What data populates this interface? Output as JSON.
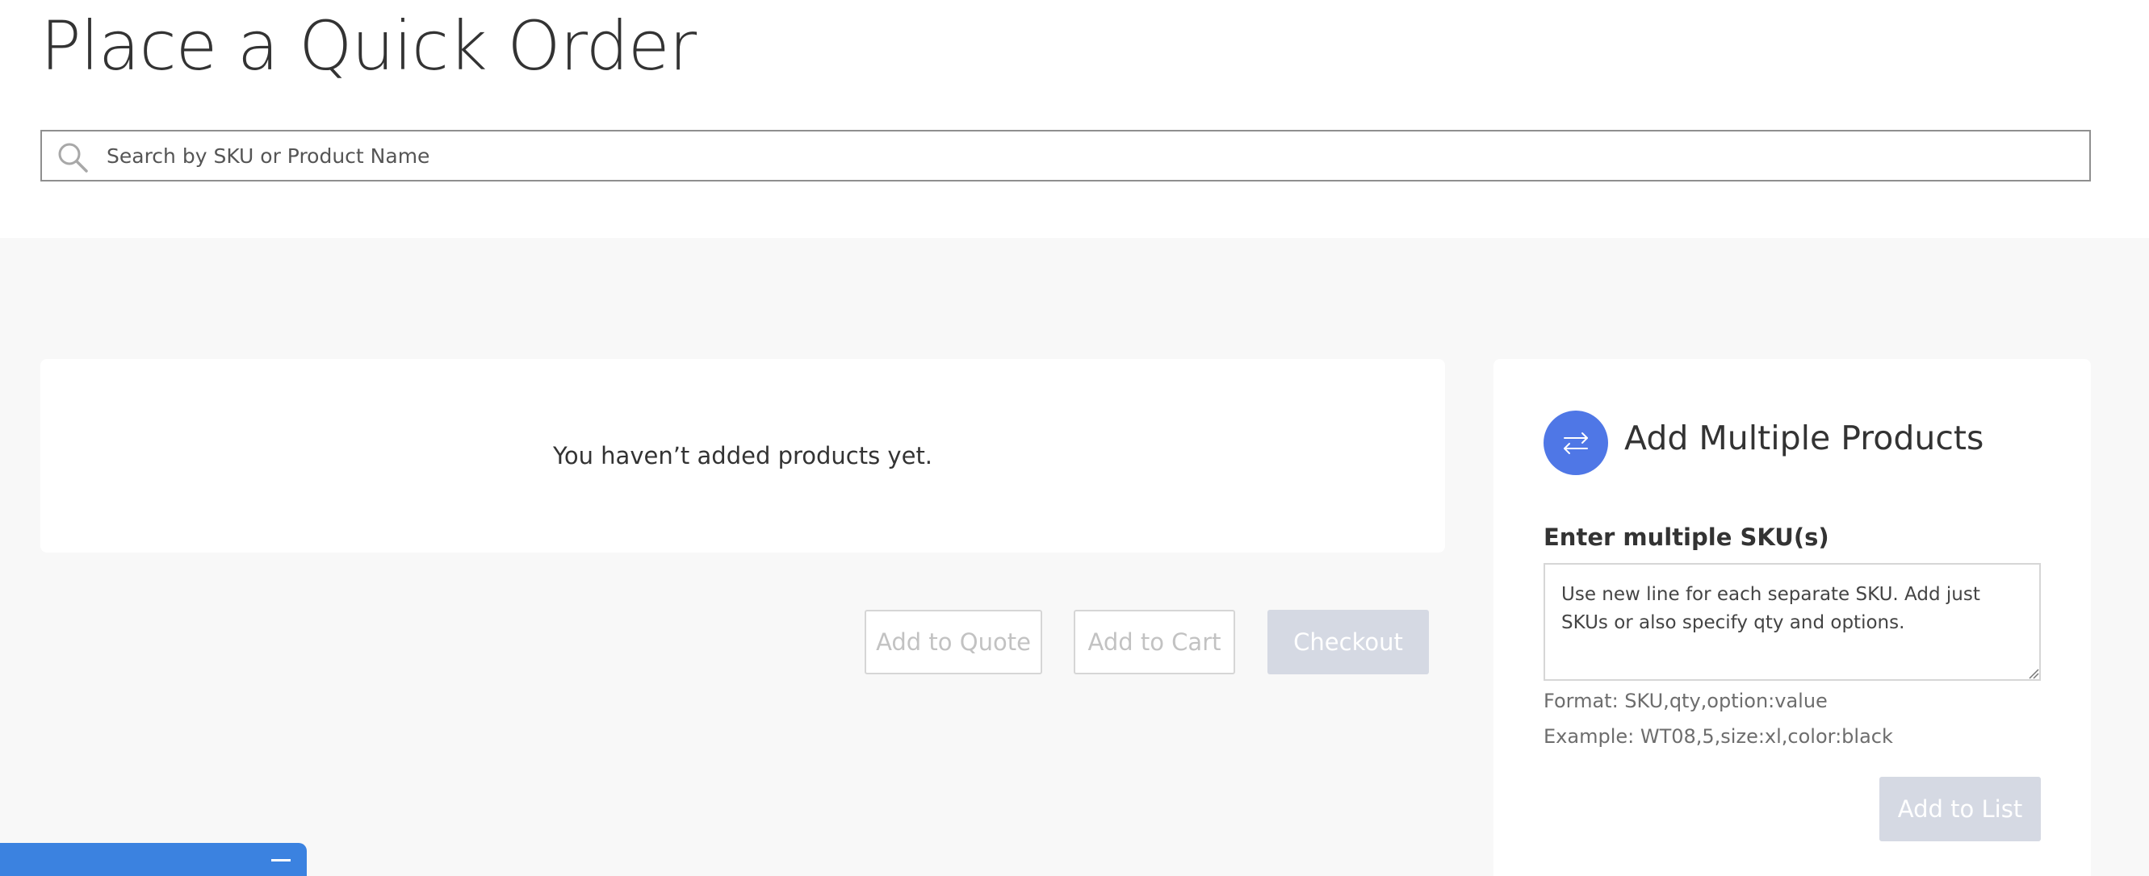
{
  "page": {
    "title": "Place a Quick Order"
  },
  "search": {
    "placeholder": "Search by SKU or Product Name"
  },
  "products": {
    "empty_message": "You haven’t added products yet."
  },
  "actions": {
    "add_to_quote": "Add to Quote",
    "add_to_cart": "Add to Cart",
    "checkout": "Checkout"
  },
  "multiple": {
    "title": "Add Multiple Products",
    "sku_label": "Enter multiple SKU(s)",
    "sku_placeholder": "Use new line for each separate SKU. Add just SKUs or also specify qty and options.",
    "format_hint": "Format: SKU,qty,option:value",
    "example_hint": "Example: WT08,5,size:xl,color:black",
    "add_to_list": "Add to List"
  },
  "icons": {
    "search": "search-icon",
    "swap": "swap-arrows-icon",
    "minimize": "minimize-icon"
  },
  "colors": {
    "accent": "#4f77e6",
    "disabled_button": "#d5d9e3",
    "chat_bar": "#3b82e0",
    "background_gray": "#f8f8f8"
  }
}
